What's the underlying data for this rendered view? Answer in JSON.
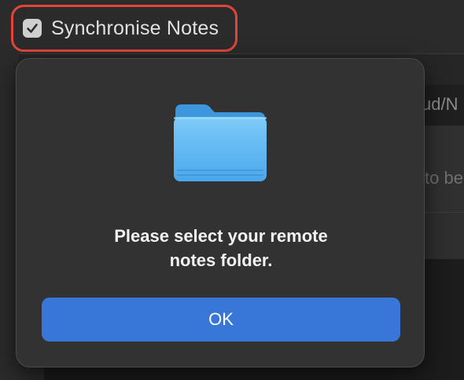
{
  "settings": {
    "sync_checkbox_label": "Synchronise Notes",
    "sync_checked": true,
    "path_field_partial": "ud/N",
    "hint_partial": "to be"
  },
  "dialog": {
    "icon": "folder-icon",
    "message_line1": "Please select your remote",
    "message_line2": "notes folder.",
    "ok_label": "OK"
  },
  "colors": {
    "highlight_outline": "#e0453a",
    "accent_button": "#3876d8",
    "folder_blue": "#5ab4f0"
  }
}
